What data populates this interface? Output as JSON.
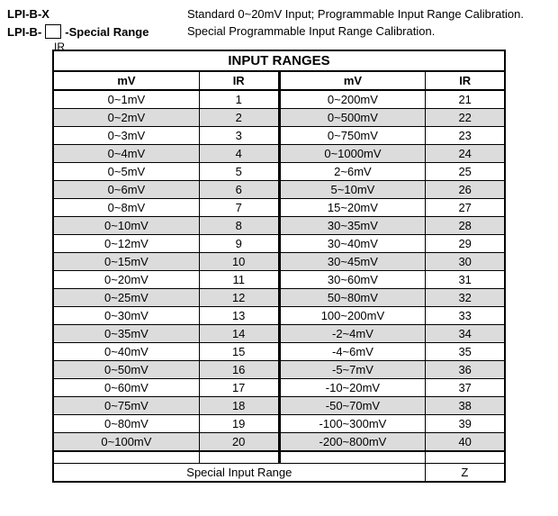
{
  "definitions": [
    {
      "key": "LPI-B-X",
      "text": "Standard 0~20mV Input; Programmable Input Range Calibration."
    }
  ],
  "def2": {
    "prefix": "LPI-B-",
    "box_sub": "IR",
    "suffix": "-Special Range",
    "text": "Special Programmable Input Range Calibration."
  },
  "table": {
    "title": "INPUT RANGES",
    "hdr_mv": "mV",
    "hdr_ir": "IR",
    "left": [
      {
        "mv": "0~1mV",
        "ir": "1"
      },
      {
        "mv": "0~2mV",
        "ir": "2"
      },
      {
        "mv": "0~3mV",
        "ir": "3"
      },
      {
        "mv": "0~4mV",
        "ir": "4"
      },
      {
        "mv": "0~5mV",
        "ir": "5"
      },
      {
        "mv": "0~6mV",
        "ir": "6"
      },
      {
        "mv": "0~8mV",
        "ir": "7"
      },
      {
        "mv": "0~10mV",
        "ir": "8"
      },
      {
        "mv": "0~12mV",
        "ir": "9"
      },
      {
        "mv": "0~15mV",
        "ir": "10"
      },
      {
        "mv": "0~20mV",
        "ir": "11"
      },
      {
        "mv": "0~25mV",
        "ir": "12"
      },
      {
        "mv": "0~30mV",
        "ir": "13"
      },
      {
        "mv": "0~35mV",
        "ir": "14"
      },
      {
        "mv": "0~40mV",
        "ir": "15"
      },
      {
        "mv": "0~50mV",
        "ir": "16"
      },
      {
        "mv": "0~60mV",
        "ir": "17"
      },
      {
        "mv": "0~75mV",
        "ir": "18"
      },
      {
        "mv": "0~80mV",
        "ir": "19"
      },
      {
        "mv": "0~100mV",
        "ir": "20"
      }
    ],
    "right": [
      {
        "mv": "0~200mV",
        "ir": "21"
      },
      {
        "mv": "0~500mV",
        "ir": "22"
      },
      {
        "mv": "0~750mV",
        "ir": "23"
      },
      {
        "mv": "0~1000mV",
        "ir": "24"
      },
      {
        "mv": "2~6mV",
        "ir": "25"
      },
      {
        "mv": "5~10mV",
        "ir": "26"
      },
      {
        "mv": "15~20mV",
        "ir": "27"
      },
      {
        "mv": "30~35mV",
        "ir": "28"
      },
      {
        "mv": "30~40mV",
        "ir": "29"
      },
      {
        "mv": "30~45mV",
        "ir": "30"
      },
      {
        "mv": "30~60mV",
        "ir": "31"
      },
      {
        "mv": "50~80mV",
        "ir": "32"
      },
      {
        "mv": "100~200mV",
        "ir": "33"
      },
      {
        "mv": "-2~4mV",
        "ir": "34"
      },
      {
        "mv": "-4~6mV",
        "ir": "35"
      },
      {
        "mv": "-5~7mV",
        "ir": "36"
      },
      {
        "mv": "-10~20mV",
        "ir": "37"
      },
      {
        "mv": "-50~70mV",
        "ir": "38"
      },
      {
        "mv": "-100~300mV",
        "ir": "39"
      },
      {
        "mv": "-200~800mV",
        "ir": "40"
      }
    ],
    "special": {
      "label": "Special Input Range",
      "ir": "Z"
    }
  }
}
